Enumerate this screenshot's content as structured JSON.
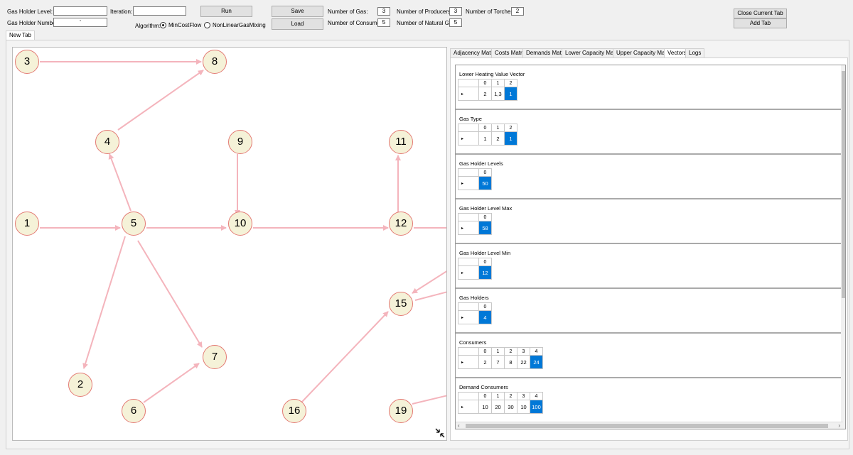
{
  "toolbar": {
    "gas_holder_level_label": "Gas Holder Level:",
    "gas_holder_number_label": "Gas Holder Number:",
    "iteration_label": "Iteration:",
    "gas_holder_level_value": "",
    "gas_holder_number_value": "'",
    "iteration_value": "",
    "algorithm_label": "Algorithm:",
    "algo_option_1": "MinCostFlow",
    "algo_option_2": "NonLinearGasMixing",
    "run_label": "Run",
    "save_label": "Save",
    "load_label": "Load",
    "num_gas_label": "Number of Gas:",
    "num_gas_value": "3",
    "num_consumers_label": "Number of Consumers:",
    "num_consumers_value": "5",
    "num_producers_label": "Number of Producers:",
    "num_producers_value": "3",
    "num_natural_gas_label": "Number of Natural Gas:",
    "num_natural_gas_value": "5",
    "num_torches_label": "Number of Torches:",
    "num_torches_value": "2",
    "close_tab_label": "Close Current Tab",
    "add_tab_label": "Add Tab"
  },
  "doc_tabs": [
    "New Tab"
  ],
  "graph": {
    "edge_color": "#f4b4bc",
    "node_fill": "#f5f2d8",
    "node_border": "#e37a74",
    "nodes": [
      "3",
      "8",
      "4",
      "9",
      "11",
      "1",
      "5",
      "10",
      "12",
      "15",
      "7",
      "2",
      "6",
      "16",
      "19"
    ]
  },
  "side_tabs": [
    "Adjacency Matrix",
    "Costs Matrix",
    "Demands Matrix",
    "Lower Capacity Matrix",
    "Upper Capacity Matrix",
    "Vectors",
    "Logs"
  ],
  "side_tab_selected": "Vectors",
  "vectors": [
    {
      "title": "Lower Heating Value Vector",
      "cols": [
        "0",
        "1",
        "2"
      ],
      "vals": [
        "2",
        "1,3",
        "1"
      ]
    },
    {
      "title": "Gas Type",
      "cols": [
        "0",
        "1",
        "2"
      ],
      "vals": [
        "1",
        "2",
        "1"
      ]
    },
    {
      "title": "Gas Holder Levels",
      "cols": [
        "0"
      ],
      "vals": [
        "50"
      ]
    },
    {
      "title": "Gas Holder Level Max",
      "cols": [
        "0"
      ],
      "vals": [
        "58"
      ]
    },
    {
      "title": "Gas Holder Level Min",
      "cols": [
        "0"
      ],
      "vals": [
        "12"
      ]
    },
    {
      "title": "Gas Holders",
      "cols": [
        "0"
      ],
      "vals": [
        "4"
      ]
    },
    {
      "title": "Consumers",
      "cols": [
        "0",
        "1",
        "2",
        "3",
        "4"
      ],
      "vals": [
        "2",
        "7",
        "8",
        "22",
        "24"
      ]
    },
    {
      "title": "Demand Consumers",
      "cols": [
        "0",
        "1",
        "2",
        "3",
        "4"
      ],
      "vals": [
        "10",
        "20",
        "30",
        "10",
        "100"
      ]
    }
  ],
  "accent": "#0078d7",
  "row_marker": "▸"
}
